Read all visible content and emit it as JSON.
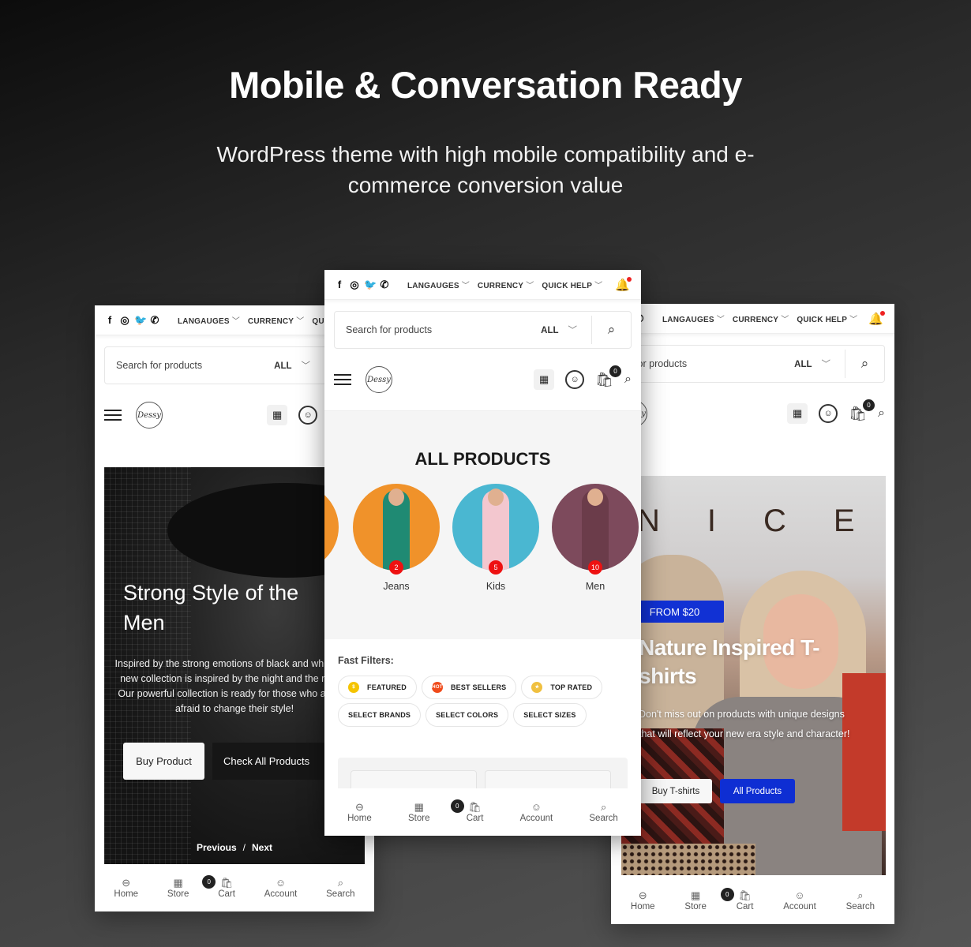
{
  "hero": {
    "title": "Mobile & Conversation Ready",
    "subtitle": "WordPress theme with high mobile compatibility and e-commerce conversion value"
  },
  "shared": {
    "social_icons": [
      "facebook-icon",
      "instagram-icon",
      "twitter-icon",
      "viber-icon"
    ],
    "social_glyphs": [
      "f",
      "◎",
      "🐦",
      "✆"
    ],
    "top_menu": [
      {
        "label": "LANGAUGES",
        "chev": "﹀"
      },
      {
        "label": "CURRENCY",
        "chev": "﹀"
      },
      {
        "label": "QUICK HELP",
        "chev": "﹀"
      }
    ],
    "bell_glyph": "🔔",
    "search": {
      "placeholder": "Search for products",
      "category": "ALL",
      "chev": "﹀",
      "icon": "⌕"
    },
    "logo_text": "Dessy",
    "cart_count": "0",
    "bottom_nav": [
      {
        "label": "Home",
        "icon": "⊖"
      },
      {
        "label": "Store",
        "icon": "▦"
      },
      {
        "label": "Cart",
        "icon": "🛍"
      },
      {
        "label": "Account",
        "icon": "☺"
      },
      {
        "label": "Search",
        "icon": "⌕"
      }
    ]
  },
  "left_phone": {
    "slide": {
      "title": "Strong Style of the Men",
      "text": "Inspired by the strong emotions of black and white, our new collection is inspired by the night and the moon. Our powerful collection is ready for those who are not afraid to change their style!",
      "buy_button": "Buy Product",
      "all_button": "Check All Products",
      "prev": "Previous",
      "separator": "/",
      "next": "Next"
    }
  },
  "center_phone": {
    "section_title": "ALL PRODUCTS",
    "categories": [
      {
        "name": "Jeans",
        "count": "2",
        "bg": "#f0922a",
        "outfit": "#1f8a73"
      },
      {
        "name": "Kids",
        "count": "5",
        "bg": "#4ab7d1",
        "outfit": "#f3c7cf"
      },
      {
        "name": "Men",
        "count": "10",
        "bg": "#7d4a5c",
        "outfit": "#6b3c4a"
      }
    ],
    "fast_filters_label": "Fast Filters:",
    "filters": [
      {
        "label": "FEATURED",
        "icon": "coin-icon",
        "color": "#f5c400",
        "glyph": "$"
      },
      {
        "label": "BEST SELLERS",
        "icon": "hot-badge-icon",
        "color": "#f04a1a",
        "glyph": "HOT"
      },
      {
        "label": "TOP RATED",
        "icon": "thumbs-up-stars-icon",
        "color": "#f0c040",
        "glyph": "★"
      },
      {
        "label": "SELECT BRANDS"
      },
      {
        "label": "SELECT COLORS"
      },
      {
        "label": "SELECT SIZES"
      }
    ]
  },
  "right_phone": {
    "slide": {
      "sign_text": "NICE",
      "price_badge": "FROM $20",
      "title": "Nature Inspired T-shirts",
      "text": "Don't miss out on products with unique designs that will reflect your new era style and character!",
      "buy_button": "Buy T-shirts",
      "all_button": "All Products"
    }
  },
  "colors": {
    "accent_blue": "#0e2ed3",
    "badge_red": "#e11111",
    "dark": "#222222"
  }
}
